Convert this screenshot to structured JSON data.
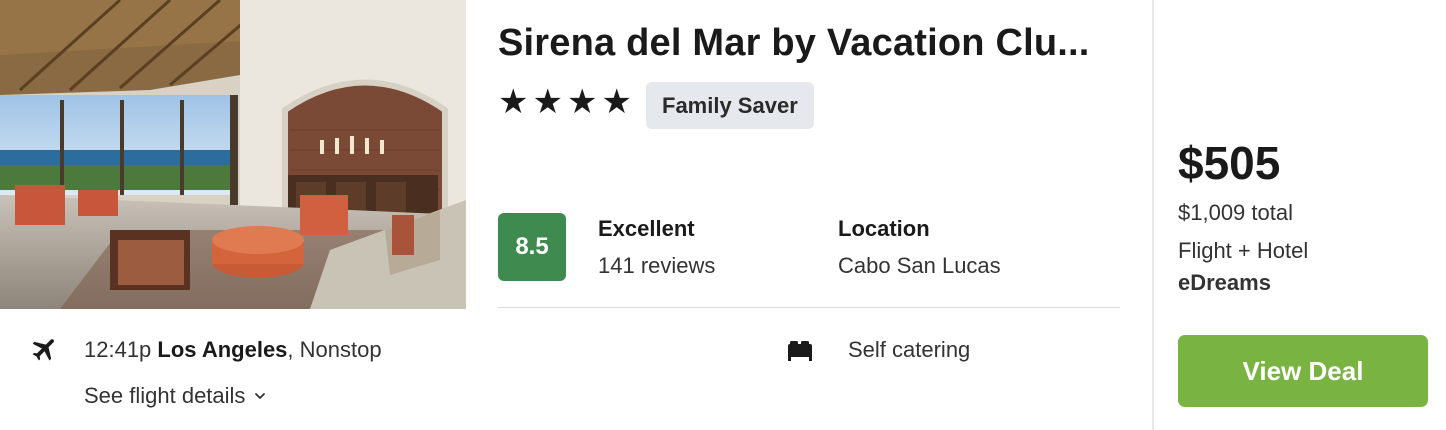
{
  "hotel": {
    "name": "Sirena del Mar by Vacation Clu...",
    "star_count": 4,
    "star_glyph": "★",
    "badge": "Family Saver",
    "image_alt": "Hotel lobby with ocean view",
    "rating": {
      "score": "8.5",
      "label": "Excellent",
      "reviews": "141 reviews",
      "score_color": "#3f8b4f"
    },
    "location": {
      "label": "Location",
      "value": "Cabo San Lucas"
    }
  },
  "flight": {
    "icon": "airplane-icon",
    "time": "12:41p",
    "origin": "Los Angeles",
    "stops": ", Nonstop",
    "details_link": "See flight details"
  },
  "amenity": {
    "icon": "bed-icon",
    "label": "Self catering"
  },
  "pricing": {
    "price": "$505",
    "total": "$1,009 total",
    "package": "Flight + Hotel",
    "provider": "eDreams",
    "cta": "View Deal",
    "cta_color": "#79b342"
  }
}
